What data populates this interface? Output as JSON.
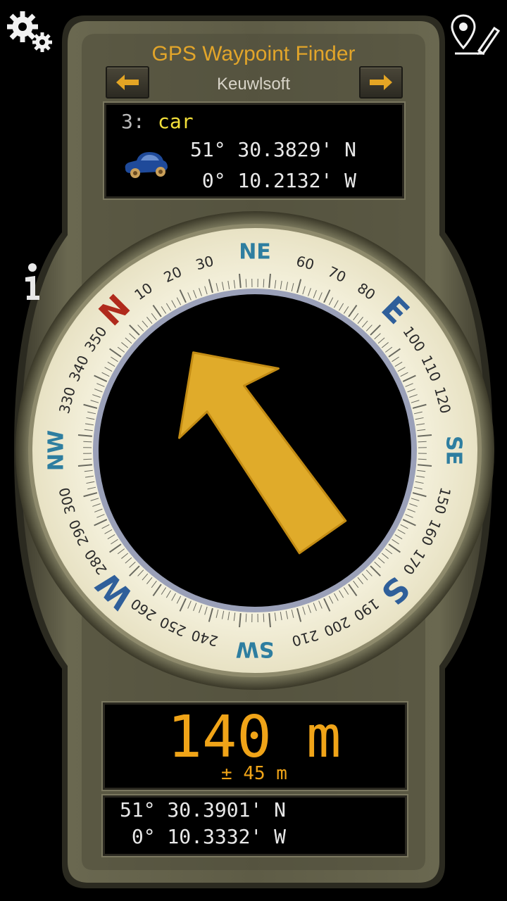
{
  "header": {
    "title": "GPS Waypoint Finder",
    "subtitle": "Keuwlsoft"
  },
  "icons": {
    "settings": "gear-icon",
    "add_waypoint": "map-pin-edit-icon",
    "info": "info-icon",
    "prev": "arrow-left-icon",
    "next": "arrow-right-icon",
    "waypoint": "car-icon"
  },
  "waypoint": {
    "number": "3:",
    "name": "car",
    "lat": "51° 30.3829' N",
    "lon": " 0° 10.2132' W"
  },
  "compass": {
    "cardinals": [
      "N",
      "NE",
      "E",
      "SE",
      "S",
      "SW",
      "W",
      "NW"
    ],
    "degree_labels": [
      "10",
      "20",
      "30",
      "60",
      "70",
      "80",
      "100",
      "110",
      "120",
      "150",
      "160",
      "170",
      "190",
      "200",
      "210",
      "240",
      "250",
      "260",
      "280",
      "290",
      "300",
      "330",
      "340",
      "350"
    ],
    "arrow_bearing_deg": -35
  },
  "distance": {
    "value": "140 m",
    "accuracy": "± 45 m"
  },
  "current_position": {
    "lat": "51° 30.3901' N",
    "lon": " 0° 10.3332' W"
  },
  "colors": {
    "accent": "#f0a418",
    "waypoint_name": "#f3e03a",
    "north": "#b02a1c",
    "cardinal": "#2f5f9a",
    "intercardinal": "#2e7ea0",
    "body": "#5d5b45"
  }
}
